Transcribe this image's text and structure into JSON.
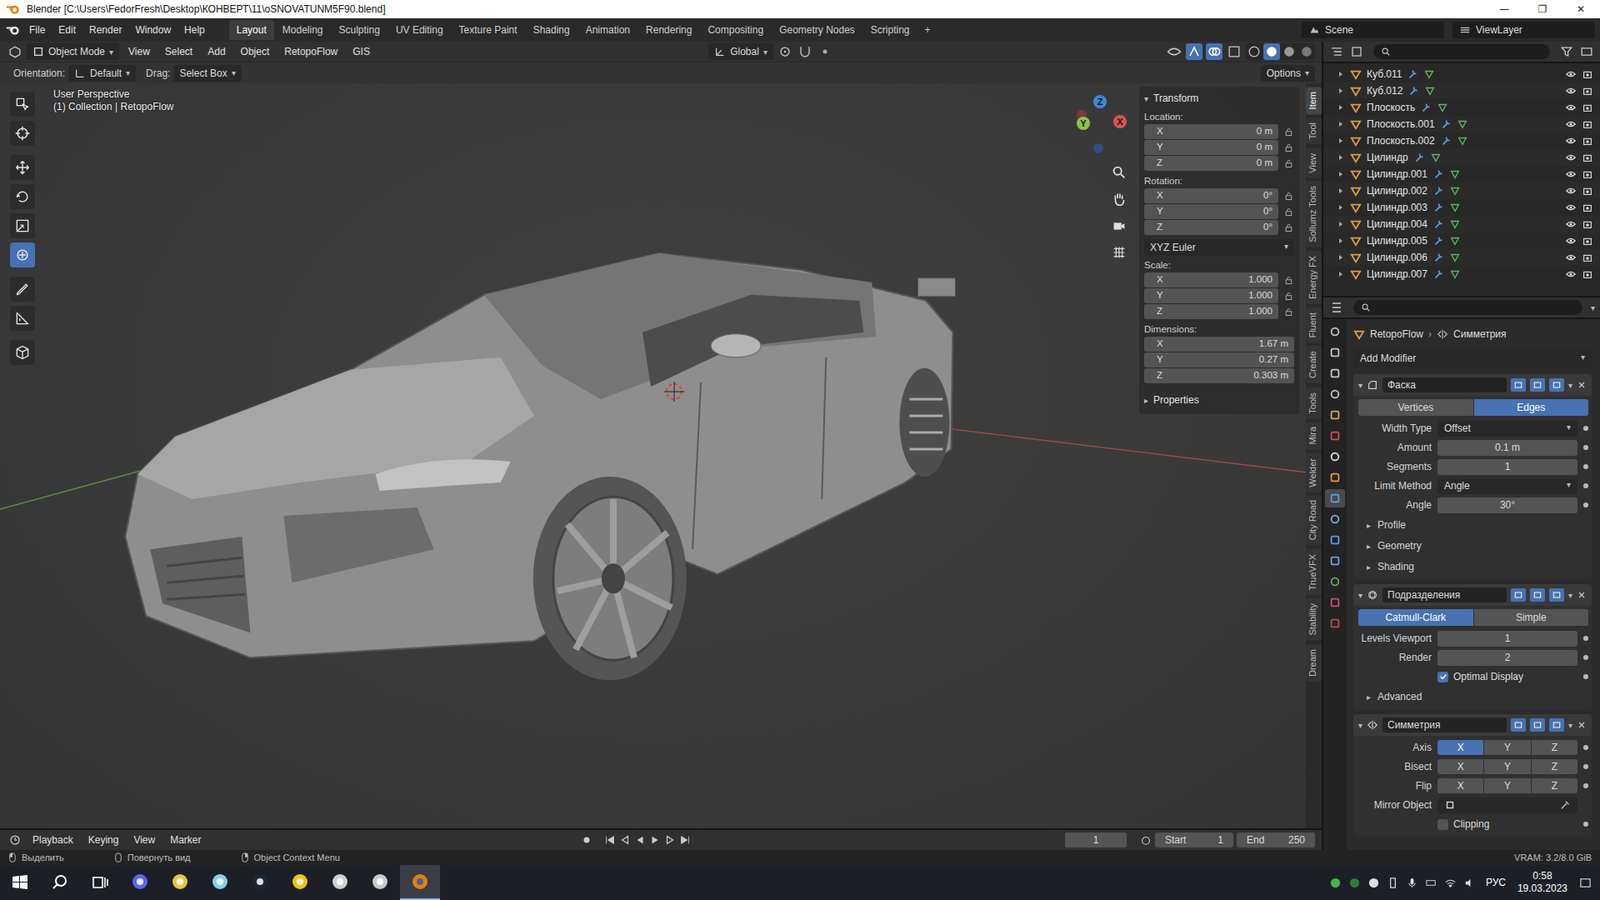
{
  "window": {
    "title": "Blender [C:\\Users\\FedorFresh\\Desktop\\КОНВЕРТ\\11\\oSNOVATUNM5F90.blend]",
    "controls": [
      "—",
      "❐",
      "✕"
    ]
  },
  "topbar": {
    "menus": [
      "File",
      "Edit",
      "Render",
      "Window",
      "Help"
    ],
    "workspaces": [
      {
        "label": "Layout",
        "selected": true
      },
      {
        "label": "Modeling",
        "selected": false
      },
      {
        "label": "Sculpting",
        "selected": false
      },
      {
        "label": "UV Editing",
        "selected": false
      },
      {
        "label": "Texture Paint",
        "selected": false
      },
      {
        "label": "Shading",
        "selected": false
      },
      {
        "label": "Animation",
        "selected": false
      },
      {
        "label": "Rendering",
        "selected": false
      },
      {
        "label": "Compositing",
        "selected": false
      },
      {
        "label": "Geometry Nodes",
        "selected": false
      },
      {
        "label": "Scripting",
        "selected": false
      }
    ],
    "add": "+",
    "scene": "Scene",
    "view_layer": "ViewLayer"
  },
  "viewport_header": {
    "mode": "Object Mode",
    "menus": [
      "View",
      "Select",
      "Add",
      "Object",
      "RetopoFlow",
      "GIS"
    ],
    "orientation": "Global"
  },
  "tool_header": {
    "orientation_label": "Orientation:",
    "orientation": "Default",
    "drag_label": "Drag:",
    "drag": "Select Box",
    "options": "Options"
  },
  "toolbar": [
    {
      "selected": false
    },
    {
      "selected": false
    },
    {
      "selected": false
    },
    {
      "selected": false
    },
    {
      "selected": false
    },
    {
      "selected": true
    },
    {
      "selected": false
    },
    {
      "selected": false
    },
    {
      "selected": false
    }
  ],
  "viewport": {
    "view": "User Perspective",
    "collection": "(1) Collection | RetopoFlow",
    "gizmo": [
      {
        "axis": "X",
        "color": "#d9534f"
      },
      {
        "axis": "Y",
        "color": "#8bc34a"
      },
      {
        "axis": "Z",
        "color": "#3f86d6"
      }
    ]
  },
  "n_panel": {
    "title": "Transform",
    "groups": [
      {
        "label": "Location:",
        "kind": "lockable",
        "fields": [
          {
            "axis": "X",
            "value": "0 m"
          },
          {
            "axis": "Y",
            "value": "0 m"
          },
          {
            "axis": "Z",
            "value": "0 m"
          }
        ],
        "mode": ""
      },
      {
        "label": "Rotation:",
        "kind": "lockable",
        "fields": [
          {
            "axis": "X",
            "value": "0°"
          },
          {
            "axis": "Y",
            "value": "0°"
          },
          {
            "axis": "Z",
            "value": "0°"
          }
        ],
        "mode": "XYZ Euler"
      },
      {
        "label": "Scale:",
        "kind": "lockable",
        "fields": [
          {
            "axis": "X",
            "value": "1.000"
          },
          {
            "axis": "Y",
            "value": "1.000"
          },
          {
            "axis": "Z",
            "value": "1.000"
          }
        ],
        "mode": ""
      },
      {
        "label": "Dimensions:",
        "kind": "plain",
        "fields": [
          {
            "axis": "X",
            "value": "1.67 m"
          },
          {
            "axis": "Y",
            "value": "0.27 m"
          },
          {
            "axis": "Z",
            "value": "0.303 m"
          }
        ],
        "mode": ""
      }
    ],
    "properties": "Properties"
  },
  "side_tabs": [
    {
      "label": "Item",
      "selected": true
    },
    {
      "label": "Tool",
      "selected": false
    },
    {
      "label": "View",
      "selected": false
    },
    {
      "label": "Sollumz Tools",
      "selected": false
    },
    {
      "label": "Energy FX",
      "selected": false
    },
    {
      "label": "Fluent",
      "selected": false
    },
    {
      "label": "Create",
      "selected": false
    },
    {
      "label": "Tools",
      "selected": false
    },
    {
      "label": "Mira",
      "selected": false
    },
    {
      "label": "Welder",
      "selected": false
    },
    {
      "label": "City Road",
      "selected": false
    },
    {
      "label": "TrueVFX",
      "selected": false
    },
    {
      "label": "Stability",
      "selected": false
    },
    {
      "label": "Dream",
      "selected": false
    }
  ],
  "outliner": {
    "items": [
      {
        "name": "Куб.011"
      },
      {
        "name": "Куб.012"
      },
      {
        "name": "Плоскость"
      },
      {
        "name": "Плоскость.001"
      },
      {
        "name": "Плоскость.002"
      },
      {
        "name": "Цилиндр"
      },
      {
        "name": "Цилиндр.001"
      },
      {
        "name": "Цилиндр.002"
      },
      {
        "name": "Цилиндр.003"
      },
      {
        "name": "Цилиндр.004"
      },
      {
        "name": "Цилиндр.005"
      },
      {
        "name": "Цилиндр.006"
      },
      {
        "name": "Цилиндр.007"
      }
    ]
  },
  "properties": {
    "tabs": [
      {
        "selected": false
      },
      {
        "selected": false
      },
      {
        "selected": false
      },
      {
        "selected": false
      },
      {
        "selected": false
      },
      {
        "selected": false
      },
      {
        "selected": false
      },
      {
        "selected": false
      },
      {
        "selected": true
      },
      {
        "selected": false
      },
      {
        "selected": false
      },
      {
        "selected": false
      },
      {
        "selected": false
      },
      {
        "selected": false
      },
      {
        "selected": false
      }
    ],
    "breadcrumb": [
      "RetopoFlow",
      "Симметрия"
    ],
    "add_modifier": "Add Modifier",
    "modifiers": [
      {
        "name": "Фаска",
        "expanded": true,
        "toggles": [
          {
            "on": true
          },
          {
            "on": true
          },
          {
            "on": true
          }
        ],
        "rows": [
          {
            "kind": "segmented",
            "options": [
              {
                "label": "Vertices",
                "selected": false
              },
              {
                "label": "Edges",
                "selected": true
              }
            ]
          },
          {
            "kind": "dropdown",
            "label": "Width Type",
            "value": "Offset"
          },
          {
            "kind": "number",
            "label": "Amount",
            "value": "0.1 m"
          },
          {
            "kind": "number",
            "label": "Segments",
            "value": "1"
          },
          {
            "kind": "dropdown",
            "label": "Limit Method",
            "value": "Angle"
          },
          {
            "kind": "number",
            "label": "Angle",
            "value": "30°"
          },
          {
            "kind": "subpanel",
            "label": "Profile",
            "expanded": false
          },
          {
            "kind": "subpanel",
            "label": "Geometry",
            "expanded": false
          },
          {
            "kind": "subpanel",
            "label": "Shading",
            "expanded": false
          }
        ]
      },
      {
        "name": "Подразделения",
        "expanded": true,
        "toggles": [
          {
            "on": true
          },
          {
            "on": true
          },
          {
            "on": true
          }
        ],
        "rows": [
          {
            "kind": "segmented",
            "options": [
              {
                "label": "Catmull-Clark",
                "selected": true
              },
              {
                "label": "Simple",
                "selected": false
              }
            ]
          },
          {
            "kind": "number",
            "label": "Levels Viewport",
            "value": "1"
          },
          {
            "kind": "number",
            "label": "Render",
            "value": "2"
          },
          {
            "kind": "checkbox",
            "label": "Optimal Display",
            "checked": true
          },
          {
            "kind": "subpanel",
            "label": "Advanced",
            "expanded": false
          }
        ]
      },
      {
        "name": "Симметрия",
        "expanded": true,
        "toggles": [
          {
            "on": true
          },
          {
            "on": true
          },
          {
            "on": true
          }
        ],
        "rows": [
          {
            "kind": "axes",
            "label": "Axis",
            "options": [
              {
                "label": "X",
                "selected": true
              },
              {
                "label": "Y",
                "selected": false
              },
              {
                "label": "Z",
                "selected": false
              }
            ]
          },
          {
            "kind": "axes",
            "label": "Bisect",
            "options": [
              {
                "label": "X",
                "selected": false
              },
              {
                "label": "Y",
                "selected": false
              },
              {
                "label": "Z",
                "selected": false
              }
            ]
          },
          {
            "kind": "axes",
            "label": "Flip",
            "options": [
              {
                "label": "X",
                "selected": false
              },
              {
                "label": "Y",
                "selected": false
              },
              {
                "label": "Z",
                "selected": false
              }
            ]
          },
          {
            "kind": "object",
            "label": "Mirror Object",
            "value": ""
          },
          {
            "kind": "checkbox",
            "label": "Clipping",
            "checked": false
          }
        ]
      }
    ]
  },
  "timeline": {
    "menus": [
      "Playback",
      "Keying",
      "View",
      "Marker"
    ],
    "frame": "1",
    "start_label": "Start",
    "start": "1",
    "end_label": "End",
    "end": "250"
  },
  "status_bar": {
    "hints": [
      "Выделить",
      "Повернуть вид",
      "Object Context Menu"
    ],
    "vram": "VRAM: 3.2/8.0 GiB"
  },
  "taskbar": {
    "apps": [
      {
        "selected": false
      },
      {
        "selected": false
      },
      {
        "selected": false
      },
      {
        "selected": false
      },
      {
        "selected": false
      },
      {
        "selected": false
      },
      {
        "selected": false
      },
      {
        "selected": true
      }
    ],
    "lang": "РУС",
    "time": "0:58",
    "date": "19.03.2023"
  }
}
